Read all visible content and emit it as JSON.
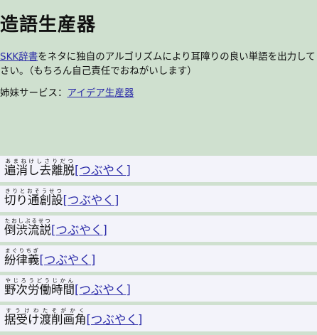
{
  "page": {
    "title": "造語生産器",
    "intro_link": "SKK辞書",
    "intro_line1_rest": "をネタに独自のアルゴリズムにより耳障りの良い単語を出力して",
    "intro_line2": "さい。（もちろん自己責任でおねがいします）",
    "sister_prefix": "姉妹サービス：",
    "sister_link": "アイデア生産器"
  },
  "results": [
    {
      "word": "遍消し去離脱",
      "reading": "あまねけしさりだつ",
      "tweet": "[つぶやく]"
    },
    {
      "word": "切り通創設",
      "reading": "きりとおそうせつ",
      "tweet": "[つぶやく]"
    },
    {
      "word": "倒渋流説",
      "reading": "たおしぶるせつ",
      "tweet": "[つぶやく]"
    },
    {
      "word": "紛律義",
      "reading": "まぐりちぎ",
      "tweet": "[つぶやく]"
    },
    {
      "word": "野次労働時間",
      "reading": "やじろうどうじかん",
      "tweet": "[つぶやく]"
    },
    {
      "word": "据受け渡削画角",
      "reading": "すうけわたそがかく",
      "tweet": "[つぶやく]"
    }
  ]
}
